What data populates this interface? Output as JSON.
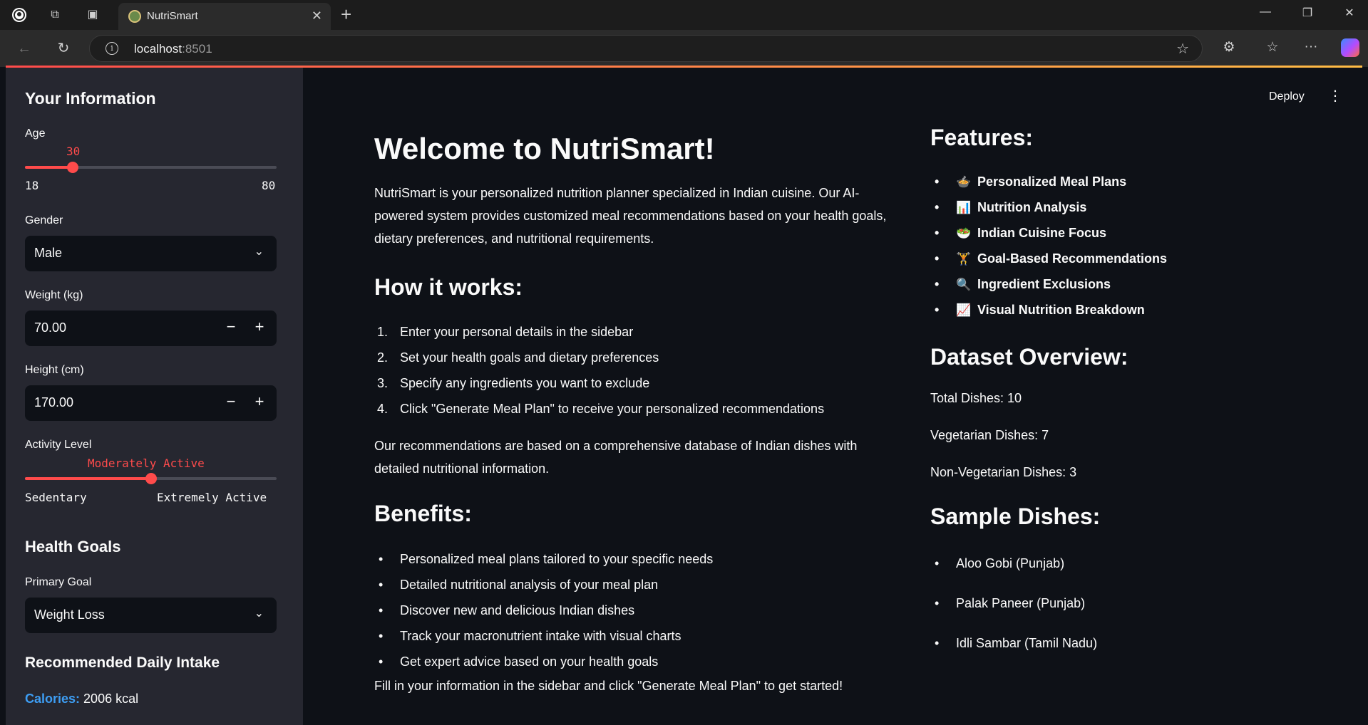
{
  "browser": {
    "tab_title": "NutriSmart",
    "url_host": "localhost",
    "url_port": ":8501"
  },
  "sidebar": {
    "info_title": "Your Information",
    "age": {
      "label": "Age",
      "value": "30",
      "min": "18",
      "max": "80",
      "fraction": 0.19
    },
    "gender": {
      "label": "Gender",
      "value": "Male"
    },
    "weight": {
      "label": "Weight (kg)",
      "value": "70.00"
    },
    "height": {
      "label": "Height (cm)",
      "value": "170.00"
    },
    "activity": {
      "label": "Activity Level",
      "value": "Moderately Active",
      "min": "Sedentary",
      "max": "Extremely Active",
      "fraction": 0.5
    },
    "health_title": "Health Goals",
    "goal": {
      "label": "Primary Goal",
      "value": "Weight Loss"
    },
    "intake_title": "Recommended Daily Intake",
    "calories_key": "Calories:",
    "calories_val": "2006 kcal"
  },
  "header": {
    "deploy": "Deploy"
  },
  "main": {
    "title": "Welcome to NutriSmart!",
    "intro_lines": [
      "NutriSmart is your personalized nutrition planner specialized in Indian cuisine. Our AI-",
      "powered system provides customized meal recommendations based on your health goals,",
      "dietary preferences, and nutritional requirements."
    ],
    "how_title": "How it works:",
    "steps": [
      "Enter your personal details in the sidebar",
      "Set your health goals and dietary preferences",
      "Specify any ingredients you want to exclude",
      "Click \"Generate Meal Plan\" to receive your personalized recommendations"
    ],
    "steps_nums": [
      "1.",
      "2.",
      "3.",
      "4."
    ],
    "database_lines": [
      "Our recommendations are based on a comprehensive database of Indian dishes with",
      "detailed nutritional information."
    ],
    "benefits_title": "Benefits:",
    "benefits": [
      "Personalized meal plans tailored to your specific needs",
      "Detailed nutritional analysis of your meal plan",
      "Discover new and delicious Indian dishes",
      "Track your macronutrient intake with visual charts",
      "Get expert advice based on your health goals"
    ],
    "cta": "Fill in your information in the sidebar and click \"Generate Meal Plan\" to get started!"
  },
  "right": {
    "features_title": "Features:",
    "features": [
      {
        "emoji": "🍲",
        "label": "Personalized Meal Plans"
      },
      {
        "emoji": "📊",
        "label": "Nutrition Analysis"
      },
      {
        "emoji": "🥗",
        "label": "Indian Cuisine Focus"
      },
      {
        "emoji": "🏋",
        "label": "Goal-Based Recommendations"
      },
      {
        "emoji": "🔍",
        "label": "Ingredient Exclusions"
      },
      {
        "emoji": "📈",
        "label": "Visual Nutrition Breakdown"
      }
    ],
    "dataset_title": "Dataset Overview:",
    "dataset": [
      "Total Dishes: 10",
      "Vegetarian Dishes: 7",
      "Non-Vegetarian Dishes: 3"
    ],
    "sample_title": "Sample Dishes:",
    "samples": [
      "Aloo Gobi (Punjab)",
      "Palak Paneer (Punjab)",
      "Idli Sambar (Tamil Nadu)"
    ]
  },
  "colors": {
    "accent": "#ff4b4b",
    "sidebar_bg": "#262730",
    "main_bg": "#0e1117",
    "info_blue": "#3d9df3"
  }
}
